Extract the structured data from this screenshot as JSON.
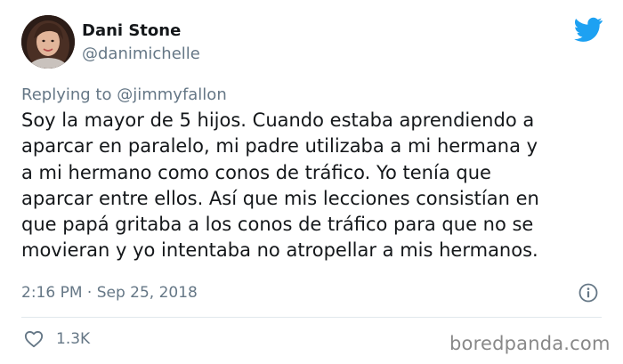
{
  "author": {
    "display_name": "Dani Stone",
    "handle": "@danimichelle"
  },
  "icons": {
    "brand": "twitter-bird-icon",
    "info": "info-icon",
    "like": "heart-icon"
  },
  "reply": {
    "prefix": "Replying to",
    "mention": "@jimmyfallon"
  },
  "body_lines": [
    "Soy la mayor de 5 hijos. Cuando estaba aprendiendo a",
    "aparcar en paralelo, mi padre utilizaba a mi hermana y",
    "a mi hermano como conos de tráfico. Yo tenía que",
    "aparcar entre ellos. Así que mis lecciones consistían en",
    "que papá gritaba a los conos de tráfico para que no se",
    "movieran y yo intentaba no atropellar a mis hermanos."
  ],
  "meta": {
    "time": "2:16 PM · Sep 25, 2018"
  },
  "stats": {
    "likes": "1.3K"
  },
  "watermark": "boredpanda.com",
  "colors": {
    "text": "#14171a",
    "secondary": "#657786",
    "brand": "#1da1f2",
    "divider": "#e1e8ed"
  }
}
